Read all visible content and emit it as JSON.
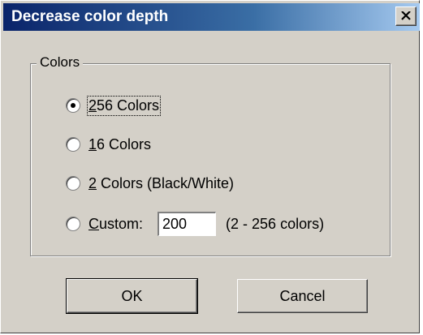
{
  "window": {
    "title": "Decrease color depth",
    "close_label": "X"
  },
  "group": {
    "label": "Colors",
    "options": [
      {
        "num": "256",
        "rest": " Colors",
        "underline": "2",
        "label": "256 Colors",
        "checked": true
      },
      {
        "label": "16 Colors",
        "underline": "1",
        "checked": false
      },
      {
        "label": "2 Colors (Black/White)",
        "underline": "2",
        "checked": false
      },
      {
        "label": "Custom:",
        "underline": "C",
        "checked": false
      }
    ],
    "custom": {
      "value": "200",
      "hint": "(2 - 256 colors)"
    }
  },
  "buttons": {
    "ok": "OK",
    "cancel": "Cancel"
  }
}
